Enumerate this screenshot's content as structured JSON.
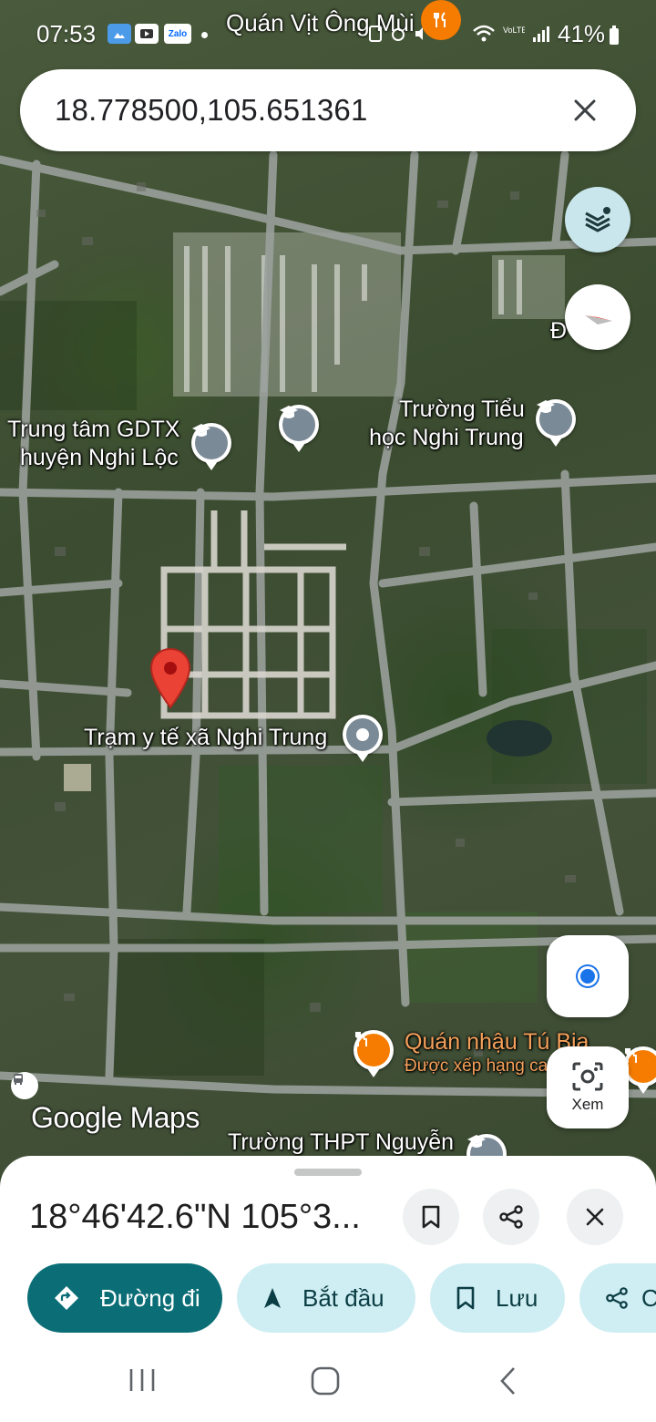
{
  "status_bar": {
    "time": "07:53",
    "notification_title": "Quán Vịt Ông Mùi",
    "app_icons": [
      "Zalo"
    ],
    "battery": "41%"
  },
  "search": {
    "query": "18.778500,105.651361"
  },
  "map": {
    "labels": {
      "gdtx": [
        "Trung tâm GDTX",
        "huyện Nghi Lộc"
      ],
      "truong_tieu_hoc": [
        "Trường Tiểu",
        "học Nghi Trung"
      ],
      "tram_y_te": "Trạm y tế xã Nghi Trung",
      "quan_nhau": "Quán nhậu Tú Bia",
      "quan_nhau_sub": "Được xếp hạng ca",
      "thpt": "Trường THPT Nguyễn",
      "duong_edge": "Đ      hên"
    },
    "logo": "Google Maps"
  },
  "buttons": {
    "lens_label": "Xem"
  },
  "sheet": {
    "title": "18°46'42.6\"N 105°3...",
    "chips": {
      "directions": "Đường đi",
      "start": "Bắt đầu",
      "save": "Lưu",
      "share": "C"
    }
  },
  "colors": {
    "primary_teal": "#0b6e76",
    "chip_light": "#cfeef3",
    "pin_red": "#ea4335",
    "location_blue": "#1a73e8"
  },
  "icons": [
    "layers-icon",
    "compass-icon",
    "my-location-icon",
    "lens-icon",
    "bookmark-icon",
    "share-icon",
    "close-icon",
    "directions-icon",
    "navigation-arrow-icon"
  ]
}
